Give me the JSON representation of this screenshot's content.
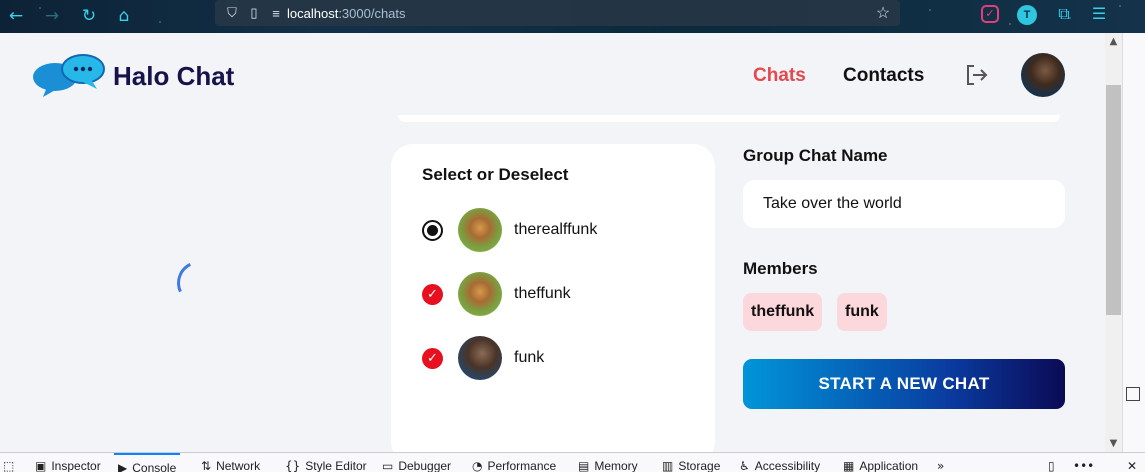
{
  "browser": {
    "url_host": "localhost",
    "url_rest": ":3000/chats"
  },
  "app": {
    "name": "Halo Chat",
    "nav": {
      "chats": "Chats",
      "contacts": "Contacts"
    },
    "colors": {
      "active_nav": "#e5484d",
      "brand": "#15134a",
      "chip_bg": "#fcd8dc",
      "check": "#e8101f"
    }
  },
  "select_panel": {
    "title": "Select or Deselect",
    "members": [
      {
        "name": "therealffunk",
        "state": "selected-radio"
      },
      {
        "name": "theffunk",
        "state": "checked"
      },
      {
        "name": "funk",
        "state": "checked"
      }
    ]
  },
  "group_form": {
    "name_label": "Group Chat Name",
    "name_value": "Take over the world",
    "members_label": "Members",
    "member_chips": [
      "theffunk",
      "funk"
    ],
    "start_button": "START A NEW CHAT"
  },
  "devtools": {
    "tabs": [
      "Inspector",
      "Console",
      "Network",
      "Style Editor",
      "Debugger",
      "Performance",
      "Memory",
      "Storage",
      "Accessibility",
      "Application"
    ],
    "selected_tab": "Console"
  }
}
